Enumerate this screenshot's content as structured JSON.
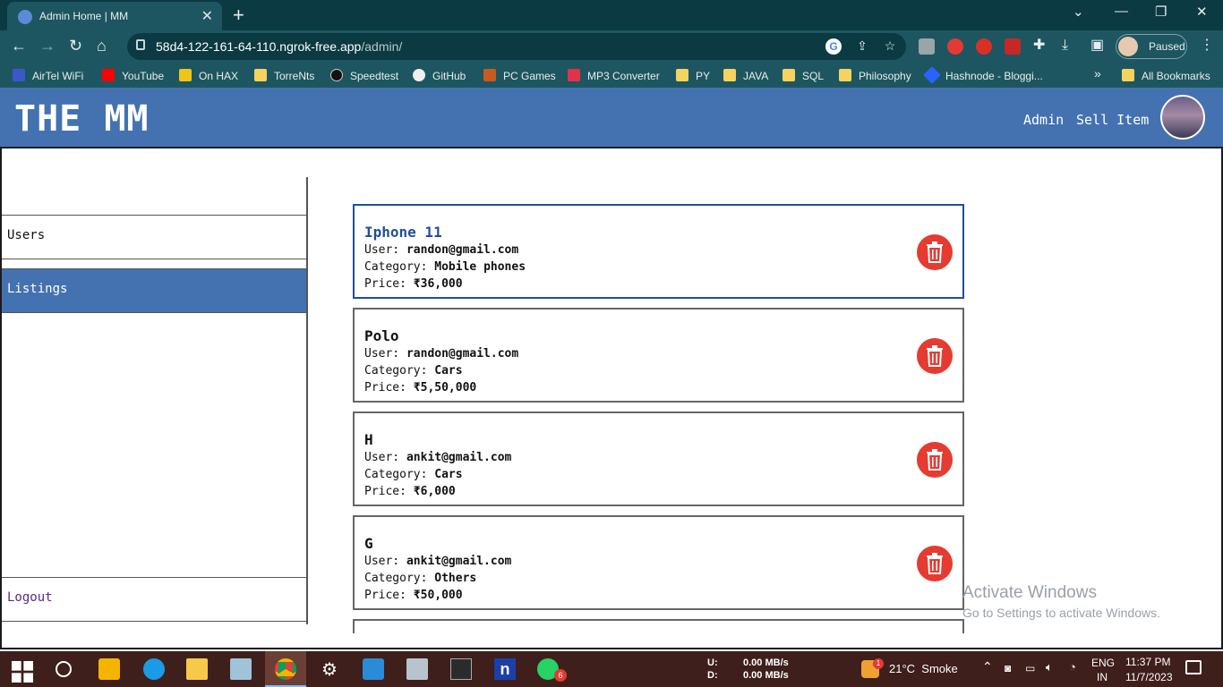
{
  "browser": {
    "tab_title": "Admin Home | MM",
    "tab_close": "✕",
    "new_tab": "+",
    "url_host": "58d4-122-161-64-110.ngrok-free.app",
    "url_path": "/admin/",
    "profile_label": "Paused",
    "window_controls": [
      "⌄",
      "—",
      "❐",
      "✕"
    ],
    "bookmarks": [
      {
        "label": "AirTel WiFi",
        "icon": "airtel-icon"
      },
      {
        "label": "YouTube",
        "icon": "youtube-icon"
      },
      {
        "label": "On HAX",
        "icon": "hax-icon"
      },
      {
        "label": "TorreNts",
        "icon": "folder-icon"
      },
      {
        "label": "Speedtest",
        "icon": "speedtest-icon"
      },
      {
        "label": "GitHub",
        "icon": "github-icon"
      },
      {
        "label": "PC Games",
        "icon": "games-icon"
      },
      {
        "label": "MP3 Converter",
        "icon": "mp3-icon"
      },
      {
        "label": "PY",
        "icon": "folder-icon"
      },
      {
        "label": "JAVA",
        "icon": "folder-icon"
      },
      {
        "label": "SQL",
        "icon": "folder-icon"
      },
      {
        "label": "Philosophy",
        "icon": "folder-icon"
      },
      {
        "label": "Hashnode - Bloggi...",
        "icon": "hashnode-icon"
      }
    ],
    "bookmarks_more": "»",
    "all_bookmarks": "All Bookmarks"
  },
  "site": {
    "logo": "THE MM",
    "nav": [
      "Admin",
      "Sell Item"
    ]
  },
  "sidebar": {
    "items": [
      {
        "label": "Users",
        "active": false
      },
      {
        "label": "Listings",
        "active": true
      }
    ],
    "logout": "Logout"
  },
  "listings": [
    {
      "name": "Iphone 11",
      "user_label": "User:",
      "user": "randon@gmail.com",
      "category_label": "Category:",
      "category": "Mobile phones",
      "price_label": "Price:",
      "price": "₹36,000"
    },
    {
      "name": "Polo",
      "user_label": "User:",
      "user": "randon@gmail.com",
      "category_label": "Category:",
      "category": "Cars",
      "price_label": "Price:",
      "price": "₹5,50,000"
    },
    {
      "name": "H",
      "user_label": "User:",
      "user": "ankit@gmail.com",
      "category_label": "Category:",
      "category": "Cars",
      "price_label": "Price:",
      "price": "₹6,000"
    },
    {
      "name": "G",
      "user_label": "User:",
      "user": "ankit@gmail.com",
      "category_label": "Category:",
      "category": "Others",
      "price_label": "Price:",
      "price": "₹50,000"
    }
  ],
  "watermark": {
    "title": "Activate Windows",
    "subtitle": "Go to Settings to activate Windows."
  },
  "taskbar": {
    "net_up_label": "U:",
    "net_down_label": "D:",
    "net_up": "0.00 MB/s",
    "net_down": "0.00 MB/s",
    "weather": "21°C  Smoke",
    "weather_badge": "1",
    "lang_top": "ENG",
    "lang_bottom": "IN",
    "time": "11:37 PM",
    "date": "11/7/2023",
    "whatsapp_badge": "6"
  },
  "colors": {
    "header": "#4472b0",
    "active_sidebar": "#4472b0",
    "delete": "#e53b30",
    "selected_title": "#1f4f9a"
  }
}
